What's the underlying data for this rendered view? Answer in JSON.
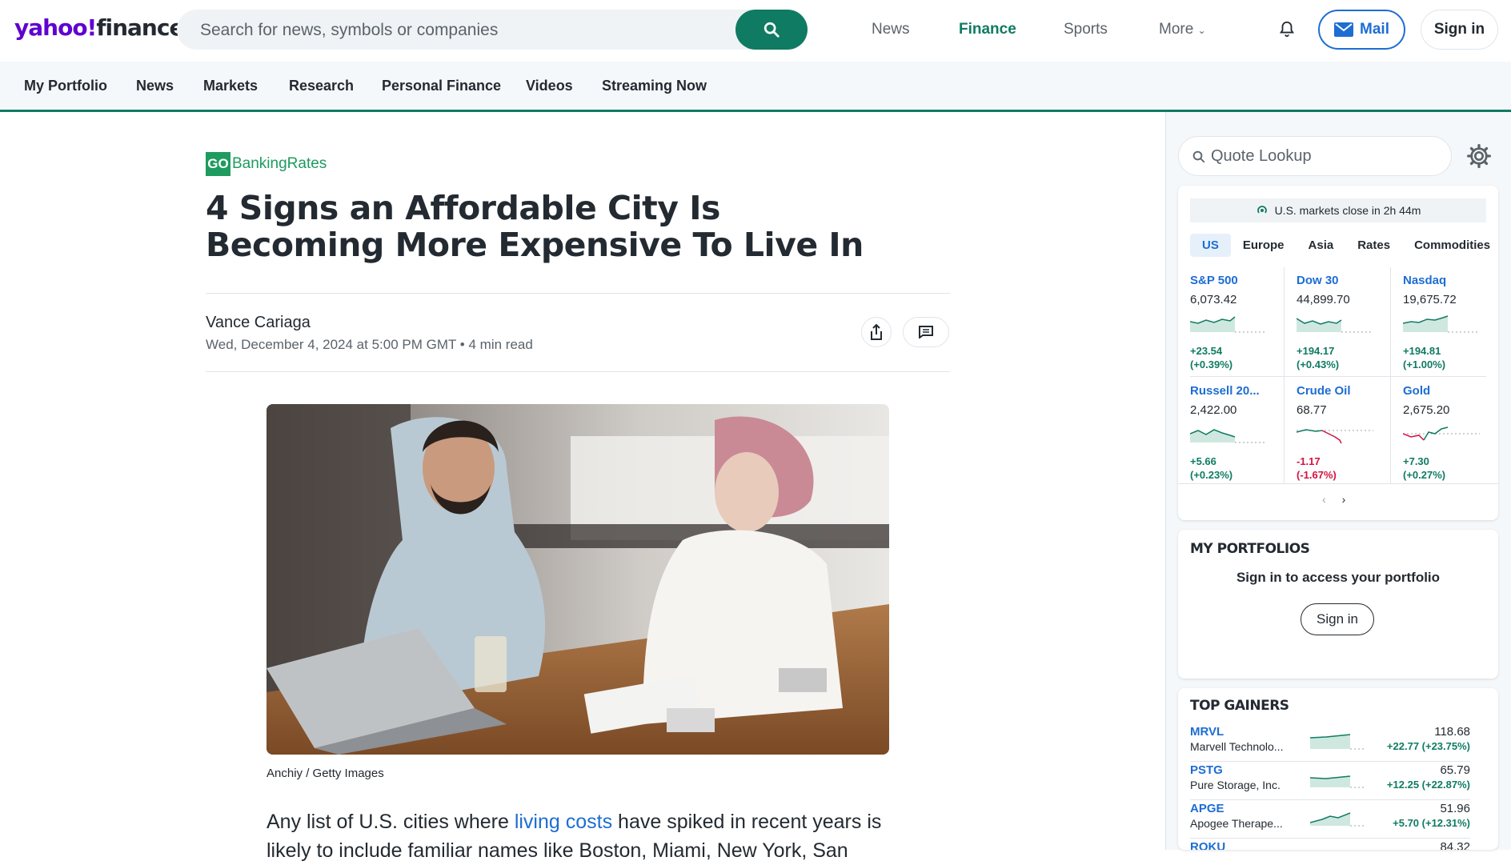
{
  "header": {
    "logo_yahoo": "yahoo!",
    "logo_finance": "finance",
    "search_placeholder": "Search for news, symbols or companies",
    "nav": [
      "News",
      "Finance",
      "Sports",
      "More"
    ],
    "mail_label": "Mail",
    "signin_label": "Sign in"
  },
  "subnav": [
    "My Portfolio",
    "News",
    "Markets",
    "Research",
    "Personal Finance",
    "Videos",
    "Streaming Now"
  ],
  "article": {
    "source_box": "GO",
    "source_name": "BankingRates",
    "title": "4 Signs an Affordable City Is Becoming More Expensive To Live In",
    "author": "Vance Cariaga",
    "date": "Wed, December 4, 2024 at 5:00 PM GMT",
    "read_time": "4 min read",
    "image_caption": "Anchiy / Getty Images",
    "body_pre": "Any list of U.S. cities where ",
    "body_link": "living costs",
    "body_post": " have spiked in recent years is likely to include familiar names like Boston, Miami, New York, San"
  },
  "rail": {
    "quote_lookup": "Quote Lookup",
    "market_status": "U.S. markets close in 2h 44m",
    "tabs": [
      "US",
      "Europe",
      "Asia",
      "Rates",
      "Commodities"
    ],
    "indices": [
      {
        "name": "S&P 500",
        "price": "6,073.42",
        "change": "+23.54",
        "pct": "(+0.39%)",
        "dir": "up"
      },
      {
        "name": "Dow 30",
        "price": "44,899.70",
        "change": "+194.17",
        "pct": "(+0.43%)",
        "dir": "up"
      },
      {
        "name": "Nasdaq",
        "price": "19,675.72",
        "change": "+194.81",
        "pct": "(+1.00%)",
        "dir": "up"
      },
      {
        "name": "Russell 20...",
        "price": "2,422.00",
        "change": "+5.66",
        "pct": "(+0.23%)",
        "dir": "up"
      },
      {
        "name": "Crude Oil",
        "price": "68.77",
        "change": "-1.17",
        "pct": "(-1.67%)",
        "dir": "dn"
      },
      {
        "name": "Gold",
        "price": "2,675.20",
        "change": "+7.30",
        "pct": "(+0.27%)",
        "dir": "up"
      }
    ],
    "portfolios_title": "MY PORTFOLIOS",
    "portfolios_msg": "Sign in to access your portfolio",
    "portfolios_signin": "Sign in",
    "gainers_title": "TOP GAINERS",
    "gainers": [
      {
        "sym": "MRVL",
        "company": "Marvell Technolo...",
        "price": "118.68",
        "change": "+22.77 (+23.75%)"
      },
      {
        "sym": "PSTG",
        "company": "Pure Storage, Inc.",
        "price": "65.79",
        "change": "+12.25 (+22.87%)"
      },
      {
        "sym": "APGE",
        "company": "Apogee Therape...",
        "price": "51.96",
        "change": "+5.70 (+12.31%)"
      },
      {
        "sym": "ROKU",
        "company": "",
        "price": "84.32",
        "change": ""
      }
    ]
  },
  "colors": {
    "brand": "#5f01d1",
    "accent": "#0f7b62",
    "link": "#1d6dd3",
    "negative": "#d3123f"
  }
}
